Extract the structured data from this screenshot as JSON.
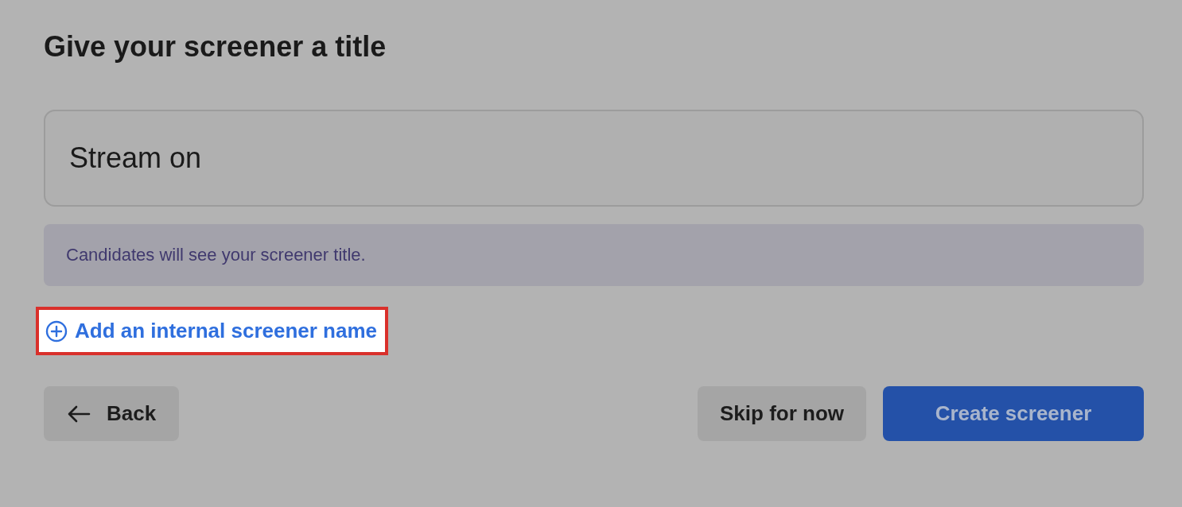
{
  "heading": "Give your screener a title",
  "title_field": {
    "value": "Stream on"
  },
  "info_note": "Candidates will see your screener title.",
  "add_link": {
    "label": "Add an internal screener name",
    "highlighted": true
  },
  "buttons": [
    {
      "kind": "back",
      "label": "Back"
    },
    {
      "kind": "secondary",
      "label": "Skip for now"
    },
    {
      "kind": "primary",
      "label": "Create screener"
    }
  ]
}
